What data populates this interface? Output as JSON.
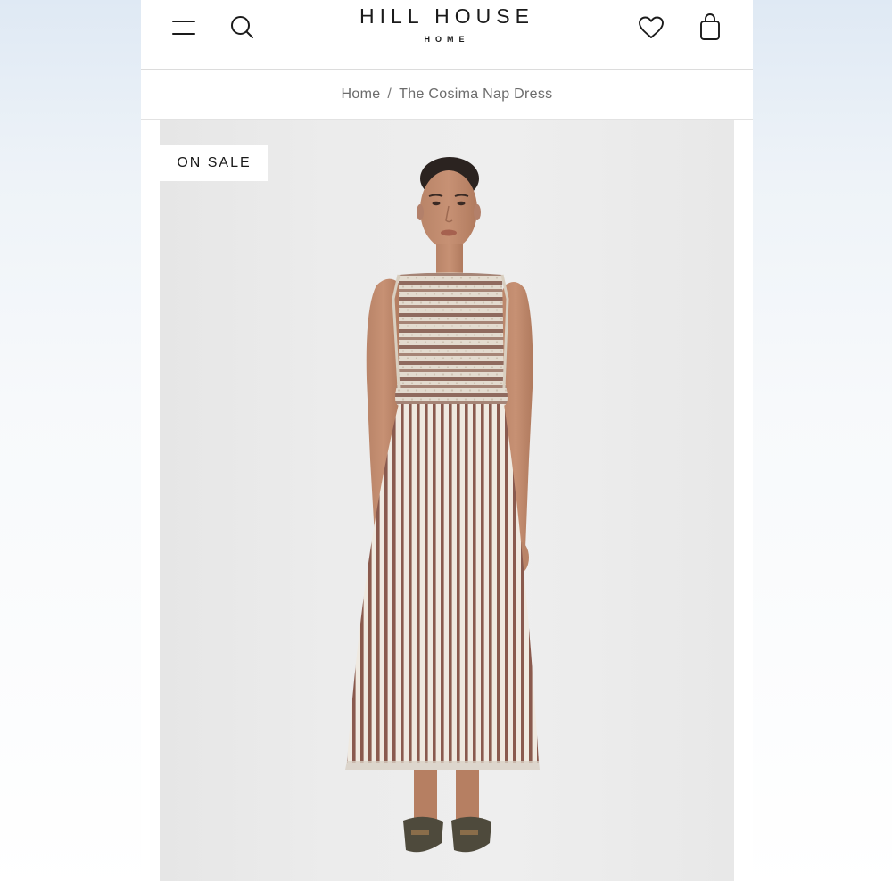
{
  "header": {
    "brand": "HILL HOUSE",
    "brand_sub": "HOME",
    "menu_icon": "hamburger-menu-icon",
    "search_icon": "search-icon",
    "wishlist_icon": "heart-icon",
    "bag_icon": "shopping-bag-icon"
  },
  "breadcrumb": {
    "home": "Home",
    "separator": "/",
    "current": "The Cosima Nap Dress"
  },
  "product": {
    "badge": "ON SALE",
    "image_subject": "model wearing striped sleeveless smocked midi dress"
  },
  "colors": {
    "stripe": "#8a5a4e",
    "cream": "#efe9e0",
    "image_bg": "#ececec",
    "text": "#1a1a1a"
  }
}
